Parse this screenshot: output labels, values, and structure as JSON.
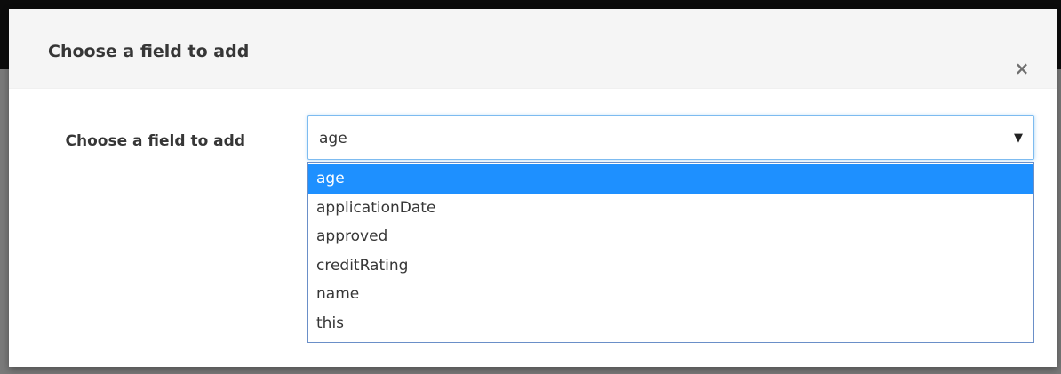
{
  "dialog": {
    "title": "Choose a field to add",
    "close_symbol": "×"
  },
  "form": {
    "label": "Choose a field to add",
    "select": {
      "value": "age",
      "caret_icon": "caret-down-icon",
      "caret_symbol": "▼",
      "options": [
        "age",
        "applicationDate",
        "approved",
        "creditRating",
        "name",
        "this"
      ],
      "selected_index": 0
    }
  },
  "colors": {
    "highlight": "#1e90ff",
    "focus_border": "#7dbbf0",
    "header_bg": "#f5f5f5"
  }
}
